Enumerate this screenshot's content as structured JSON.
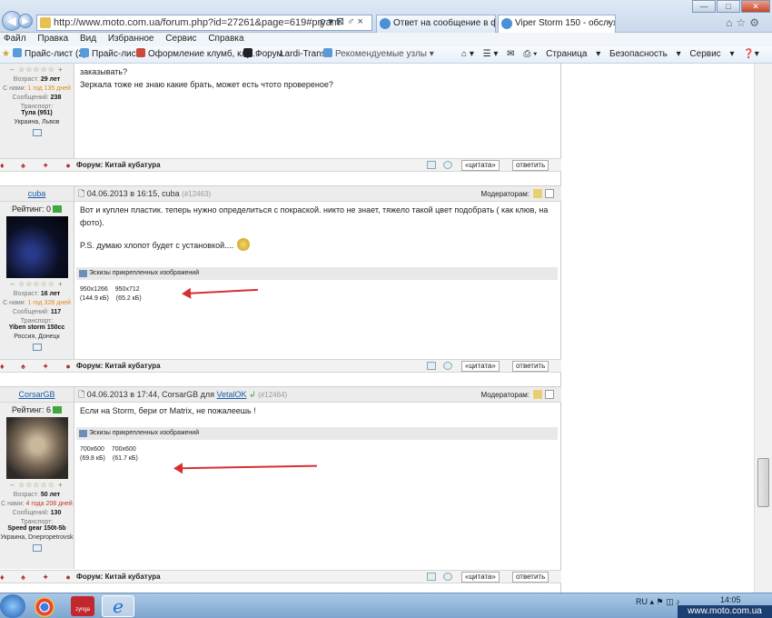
{
  "browser": {
    "url": "http://www.moto.com.ua/forum.php?id=27261&page=619#pryam",
    "tabs": [
      {
        "label": "Ответ на сообщение в фору..."
      },
      {
        "label": "Viper Storm 150 - обслужи..."
      }
    ],
    "menu": [
      "Файл",
      "Правка",
      "Вид",
      "Избранное",
      "Сервис",
      "Справка"
    ],
    "favorites": [
      "Прайс-лист (2)",
      "Прайс-лист",
      "Оформление клумб, клу...",
      "Форум",
      "Lardi-Trans",
      "Рекомендуемые узлы"
    ],
    "commands": [
      "Страница",
      "Безопасность",
      "Сервис"
    ]
  },
  "top_fragment": {
    "text_1": "заказывать?",
    "text_2": "Зеркала тоже не знаю какие брать, может есть чтото провереное?",
    "age_label": "Возраст:",
    "age": "29 лет",
    "since_label": "С нами:",
    "since": "1 год 135 дней",
    "msgs_label": "Сообщений:",
    "msgs": "238",
    "transport_label": "Транспорт:",
    "transport": "Тула (951)",
    "location": "Украина, Львов",
    "forum_label": "Форум:",
    "forum": "Китай кубатура",
    "quote": "«цитата»",
    "reply": "ответить"
  },
  "posts": [
    {
      "username": "cuba",
      "rating_label": "Рейтинг: 0",
      "date": "04.06.2013 в 16:15, cuba",
      "num": "(#12463)",
      "moderators_label": "Модераторам:",
      "body_1": "Вот и куплен пластик. теперь нужно определиться с покраской. никто не знает, тяжело такой цвет подобрать ( как клюв, на",
      "body_2": "фото).",
      "body_3": "P.S. думаю хлопот будет с установкой....",
      "attach_label": "Эскизы прикрепленных изображений",
      "thumb1": "950x1266",
      "thumb2": "950x712",
      "size1": "(144.9 кБ)",
      "size2": "(65.2 кБ)",
      "age_label": "Возраст:",
      "age": "16 лет",
      "since_label": "С нами:",
      "since": "1 год 328 дней",
      "msgs_label": "Сообщений:",
      "msgs": "117",
      "transport_label": "Транспорт:",
      "transport": "Yiben storm 150cc",
      "location": "Россия, Донецк",
      "forum_label": "Форум:",
      "forum": "Китай кубатура",
      "quote": "«цитата»",
      "reply": "ответить"
    },
    {
      "username": "CorsarGB",
      "rating_label": "Рейтинг: 6",
      "date": "04.06.2013 в 17:44, CorsarGB для",
      "to_user": "VetalOK",
      "num": "(#12464)",
      "moderators_label": "Модераторам:",
      "body_1": "Если на Storm, бери от Matrix, не пожалеешь !",
      "attach_label": "Эскизы прикрепленных изображений",
      "thumb1": "700x600",
      "thumb2": "700x600",
      "size1": "(69.8 кБ)",
      "size2": "(61.7 кБ)",
      "age_label": "Возраст:",
      "age": "50 лет",
      "since_label": "С нами:",
      "since": "4 года 208 дней",
      "msgs_label": "Сообщений:",
      "msgs": "130",
      "transport_label": "Транспорт:",
      "transport": "Speed gear 150t-5b",
      "location": "Украина, Dnepropetrovsk",
      "forum_label": "Форум:",
      "forum": "Китай кубатура",
      "quote": "«цитата»",
      "reply": "ответить"
    }
  ],
  "taskbar": {
    "lang": "RU",
    "clock": "14:05",
    "zynga": "zynga"
  },
  "watermark": "www.moto.com.ua",
  "colors": {
    "annotation_arrow": "#d72f2f",
    "link": "#1d5aa8"
  }
}
